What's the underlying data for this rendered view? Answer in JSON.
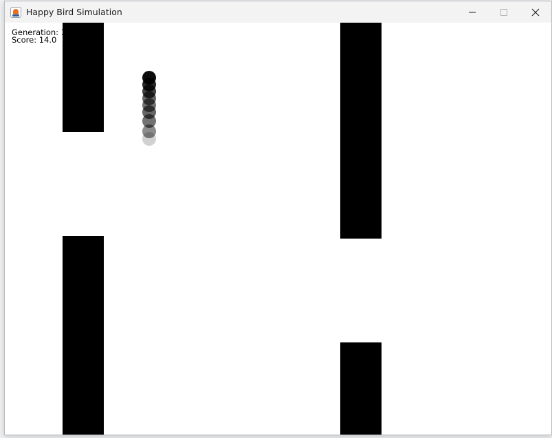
{
  "window": {
    "title": "Happy Bird Simulation",
    "icon": "java-cup-icon"
  },
  "controls": {
    "minimize_icon": "minimize-icon",
    "maximize_icon": "maximize-icon",
    "close_icon": "close-icon"
  },
  "hud": {
    "generation_label": "Generation: 1",
    "score_label": "Score: 14.0"
  },
  "colors": {
    "pipe": "#000000",
    "background": "#ffffff",
    "titlebar": "#f3f3f3"
  }
}
